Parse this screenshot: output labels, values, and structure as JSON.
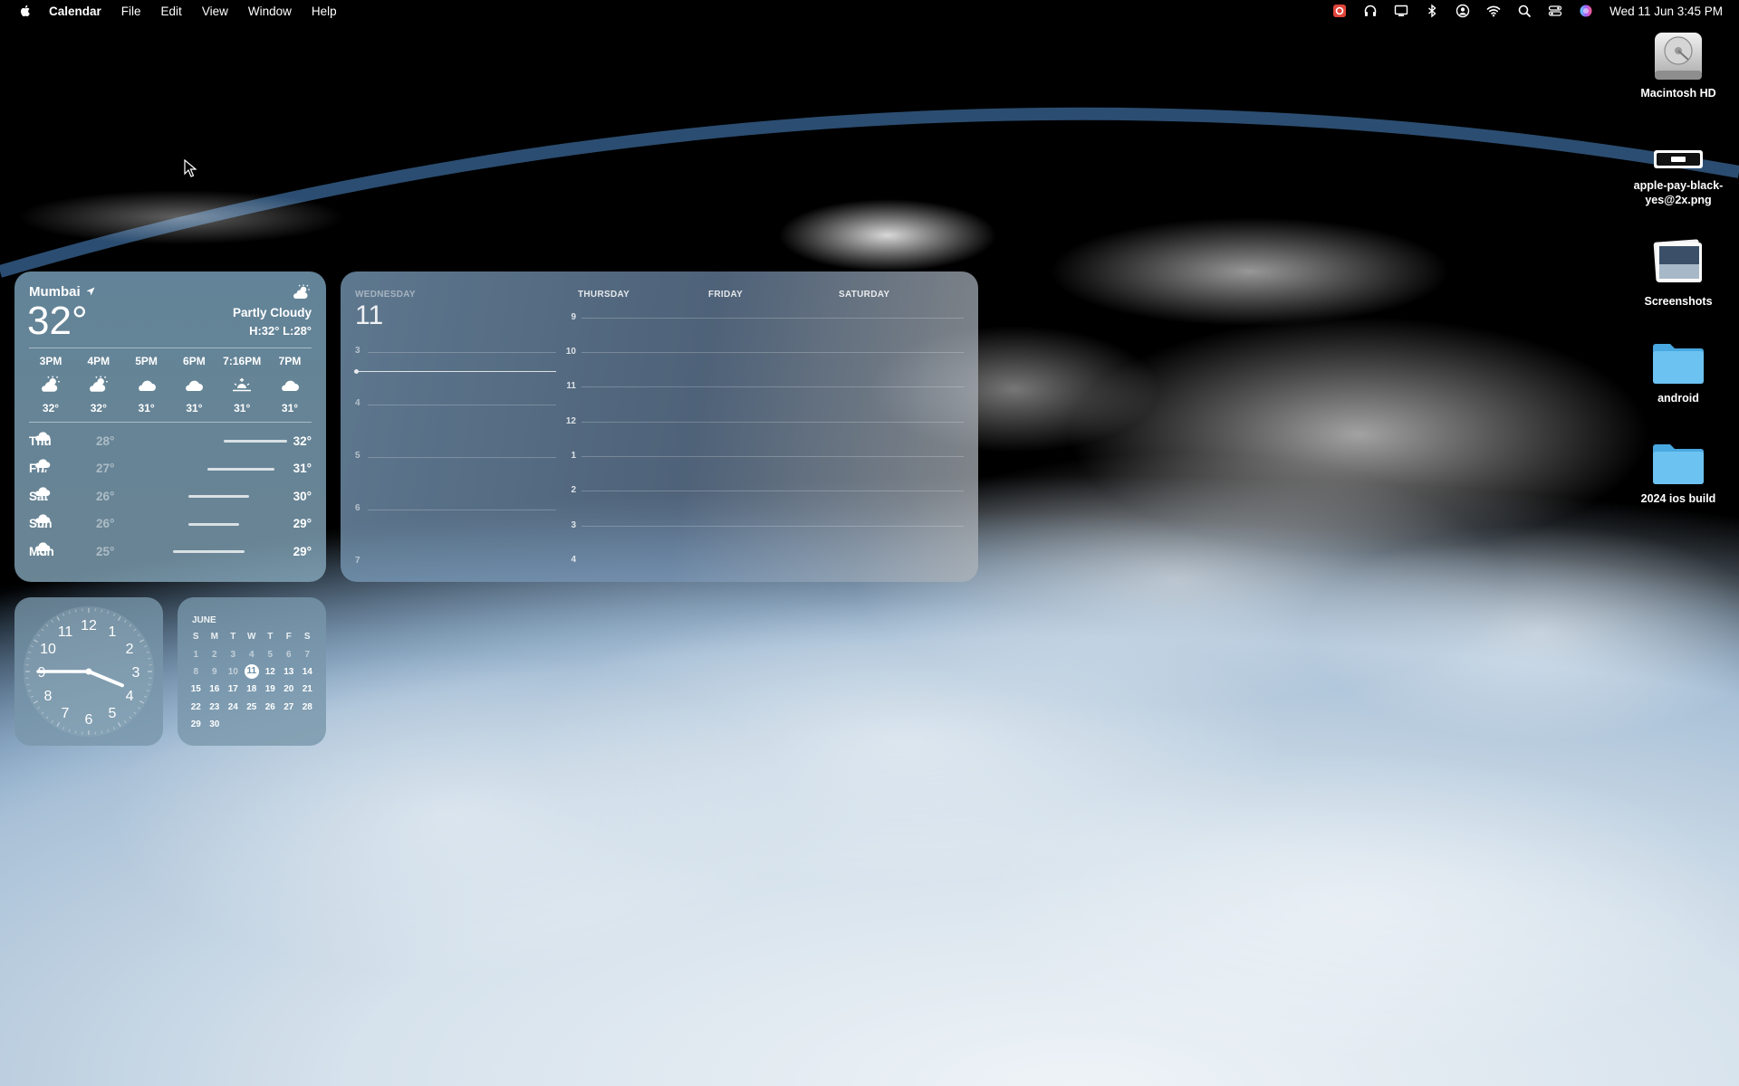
{
  "menubar": {
    "app_name": "Calendar",
    "items": [
      "File",
      "Edit",
      "View",
      "Window",
      "Help"
    ],
    "datetime": "Wed 11 Jun  3:45 PM",
    "status_icons": [
      "screen-record-icon",
      "headphones-icon",
      "display-icon",
      "bluetooth-icon",
      "user-icon",
      "wifi-icon",
      "search-icon",
      "control-center-icon",
      "siri-icon"
    ]
  },
  "weather": {
    "city": "Mumbai",
    "temperature": "32°",
    "condition": "Partly Cloudy",
    "hilo": "H:32° L:28°",
    "hourly": [
      {
        "time": "3PM",
        "icon": "partly-cloudy-icon",
        "temp": "32°"
      },
      {
        "time": "4PM",
        "icon": "partly-cloudy-icon",
        "temp": "32°"
      },
      {
        "time": "5PM",
        "icon": "cloud-icon",
        "temp": "31°"
      },
      {
        "time": "6PM",
        "icon": "cloud-icon",
        "temp": "31°"
      },
      {
        "time": "7:16PM",
        "icon": "sunset-icon",
        "temp": "31°"
      },
      {
        "time": "7PM",
        "icon": "cloud-icon",
        "temp": "31°"
      }
    ],
    "daily": [
      {
        "day": "Thu",
        "icon": "rain-icon",
        "low": "28°",
        "high": "32°"
      },
      {
        "day": "Fri",
        "icon": "rain-icon",
        "low": "27°",
        "high": "31°"
      },
      {
        "day": "Sat",
        "icon": "rain-icon",
        "low": "26°",
        "high": "30°"
      },
      {
        "day": "Sun",
        "icon": "rain-icon",
        "low": "26°",
        "high": "29°"
      },
      {
        "day": "Mon",
        "icon": "rain-icon",
        "low": "25°",
        "high": "29°"
      }
    ]
  },
  "calendar_week": {
    "today_label": "WEDNESDAY",
    "today_number": "11",
    "today_hours": [
      "3",
      "4",
      "5",
      "6",
      "7"
    ],
    "days": [
      "THURSDAY",
      "FRIDAY",
      "SATURDAY"
    ],
    "hours": [
      "9",
      "10",
      "11",
      "12",
      "1",
      "2",
      "3",
      "4"
    ]
  },
  "clock_widget": {
    "numerals": [
      "12",
      "1",
      "2",
      "3",
      "4",
      "5",
      "6",
      "7",
      "8",
      "9",
      "10",
      "11"
    ],
    "hour": 3,
    "minute": 45
  },
  "month_widget": {
    "month": "JUNE",
    "weekdays": [
      "S",
      "M",
      "T",
      "W",
      "T",
      "F",
      "S"
    ],
    "weeks": [
      [
        "1",
        "2",
        "3",
        "4",
        "5",
        "6",
        "7"
      ],
      [
        "8",
        "9",
        "10",
        "11",
        "12",
        "13",
        "14"
      ],
      [
        "15",
        "16",
        "17",
        "18",
        "19",
        "20",
        "21"
      ],
      [
        "22",
        "23",
        "24",
        "25",
        "26",
        "27",
        "28"
      ],
      [
        "29",
        "30",
        "",
        "",
        "",
        "",
        ""
      ]
    ],
    "today": "11"
  },
  "desktop": {
    "items": [
      {
        "label": "Macintosh HD",
        "icon": "hard-drive-icon"
      },
      {
        "label": "apple-pay-black-yes@2x.png",
        "icon": "image-file-icon"
      },
      {
        "label": "Screenshots",
        "icon": "screenshots-folder-icon"
      },
      {
        "label": "android",
        "icon": "folder-icon"
      },
      {
        "label": "2024 ios build",
        "icon": "folder-icon"
      }
    ]
  }
}
